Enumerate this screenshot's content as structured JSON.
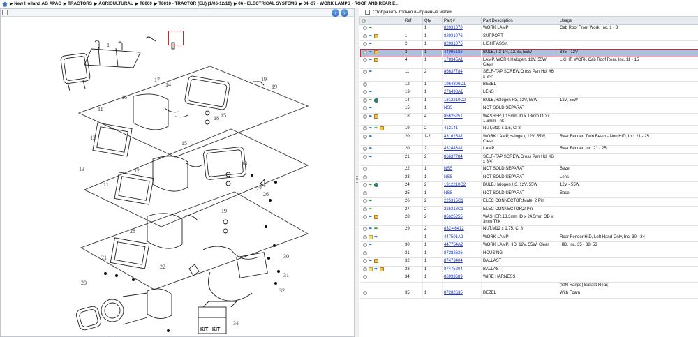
{
  "breadcrumb": [
    "New Holland AG APAC",
    "TRACTORS",
    "AGRICULTURAL",
    "T8000",
    "T8010 - TRACTOR (EU) (1/06-12/10)",
    "06 - ELECTRICAL SYSTEMS",
    "04 -37 - WORK LAMPS - ROOF AND REAR E.."
  ],
  "filter_label": "Отобразить только выбранные метки",
  "columns": {
    "ref": "Ref",
    "qty": "Qty.",
    "part": "Part #",
    "desc": "Part Description",
    "usage": "Usage"
  },
  "diagram_labels": {
    "kit": "KIT"
  },
  "rows": [
    {
      "icons": [
        "gear",
        "go"
      ],
      "ref": "",
      "qty": "1",
      "part": "82031070",
      "desc": "WORK LAMP",
      "usage": "Cab Roof Front Work, Inc. 1 - 3"
    },
    {
      "icons": [
        "gear",
        "arrow",
        "box"
      ],
      "ref": "1",
      "qty": "1",
      "part": "82031076",
      "desc": "SUPPORT",
      "usage": ""
    },
    {
      "icons": [
        "gear",
        "arrow"
      ],
      "ref": "2",
      "qty": "1",
      "part": "82031075",
      "desc": "LIGHT ASSY.",
      "usage": ""
    },
    {
      "icons": [
        "gear",
        "arrow",
        "box"
      ],
      "ref": "3",
      "qty": "1",
      "part": "44995182",
      "desc": "BULB,T-3 1/4, 12.8V, 55W",
      "usage": "885 - 12V",
      "selected": true
    },
    {
      "icons": [
        "gear",
        "arrow",
        "box"
      ],
      "ref": "4",
      "qty": "1",
      "part": "178345A1",
      "desc": "LAMP, WORK,Halogen, 12V, 55W, Clear",
      "usage": "LIGHT, WORK Cab Roof Rear, Inc. 11 - 15"
    },
    {
      "icons": [
        "gear",
        "arrow"
      ],
      "ref": "11",
      "qty": "2",
      "part": "86637784",
      "desc": "SELF-TAP SCREW,Cross Pan Hd, #6 x 3/4\"",
      "usage": ""
    },
    {
      "icons": [
        "gear"
      ],
      "ref": "12",
      "qty": "1",
      "part": "1964806C1",
      "desc": "BEZEL",
      "usage": ""
    },
    {
      "icons": [
        "gear",
        "arrow"
      ],
      "ref": "13",
      "qty": "1",
      "part": "276498A1",
      "desc": "LENS",
      "usage": ""
    },
    {
      "icons": [
        "gear",
        "go",
        "globe"
      ],
      "ref": "14",
      "qty": "1",
      "part": "1312210C2",
      "desc": "BULB,Halogen H3, 12V, 55W",
      "usage": "12V, 55W"
    },
    {
      "icons": [
        "gear",
        "arrow"
      ],
      "ref": "15",
      "qty": "1",
      "part": "NSS",
      "desc": "NOT SOLD SEPARAT",
      "usage": ""
    },
    {
      "icons": [
        "gear",
        "arrow",
        "box"
      ],
      "ref": "18",
      "qty": "4",
      "part": "86625251",
      "desc": "WASHER,10.5mm ID x 18mm OD x 1.6mm Thk",
      "usage": ""
    },
    {
      "icons": [
        "gear",
        "arrow",
        "go",
        "box"
      ],
      "ref": "19",
      "qty": "2",
      "part": "412141",
      "desc": "NUT,M10 x 1.5, Cl 8",
      "usage": ""
    },
    {
      "icons": [
        "gear",
        "arrow"
      ],
      "ref": "20",
      "qty": "1-2",
      "part": "431625A1",
      "desc": "WORK LAMP,Halogen, 12V, 55W, Clear",
      "usage": "Rear Fender, Twin Beam - Non HID, Inc. 21 - 25"
    },
    {
      "icons": [
        "gear",
        "arrow"
      ],
      "ref": "20",
      "qty": "2",
      "part": "432446A1",
      "desc": "LAMP",
      "usage": "Rear Fender, Inc. 21 - 25"
    },
    {
      "icons": [
        "gear",
        "arrow"
      ],
      "ref": "21",
      "qty": "2",
      "part": "86637784",
      "desc": "SELF-TAP SCREW,Cross Pan Hd, #6 x 3/4\"",
      "usage": ""
    },
    {
      "icons": [
        "gear"
      ],
      "ref": "22",
      "qty": "1",
      "part": "NSS",
      "desc": "NOT SOLD SEPARAT",
      "usage": "Bezel"
    },
    {
      "icons": [
        "gear"
      ],
      "ref": "23",
      "qty": "1",
      "part": "NSS",
      "desc": "NOT SOLD SEPARAT",
      "usage": "Lens"
    },
    {
      "icons": [
        "gear",
        "go",
        "globe"
      ],
      "ref": "24",
      "qty": "2",
      "part": "1312210C2",
      "desc": "BULB,Halogen H3, 12V, 55W",
      "usage": "12V - 55W"
    },
    {
      "icons": [
        "gear"
      ],
      "ref": "25",
      "qty": "1",
      "part": "NSS",
      "desc": "NOT SOLD SEPARAT",
      "usage": "Base"
    },
    {
      "icons": [
        "gear",
        "go"
      ],
      "ref": "26",
      "qty": "2",
      "part": "225315C1",
      "desc": "ELEC CONNECTOR,Male, 2 Pin",
      "usage": ""
    },
    {
      "icons": [
        "gear",
        "go"
      ],
      "ref": "27",
      "qty": "2",
      "part": "225318C1",
      "desc": "ELEC CONNECTOR,2 Pin",
      "usage": ""
    },
    {
      "icons": [
        "gear",
        "arrow",
        "box"
      ],
      "ref": "28",
      "qty": "2",
      "part": "86625255",
      "desc": "WASHER,13.3mm ID x 24.5mm OD x 3mm Thk",
      "usage": ""
    },
    {
      "icons": [
        "gear",
        "arrow",
        "go"
      ],
      "ref": "29",
      "qty": "2",
      "part": "832-46412",
      "desc": "NUT,M12 x 1.75, Cl 8",
      "usage": ""
    },
    {
      "icons": [
        "gear",
        "note",
        "arrow"
      ],
      "ref": "",
      "qty": "1",
      "part": "447501A2",
      "desc": "WORK LAMP",
      "usage": "Rear Fender HID, Left Hand Only, Inc. 30 - 34"
    },
    {
      "icons": [
        "gear",
        "arrow"
      ],
      "ref": "30",
      "qty": "1",
      "part": "447754A2",
      "desc": "WORK LAMP,HID, 12V, 55W, Clear",
      "usage": "HID, Inc. 35 - 38, 53"
    },
    {
      "icons": [
        "gear"
      ],
      "ref": "31",
      "qty": "1",
      "part": "87282636",
      "desc": "HOUSING",
      "usage": ""
    },
    {
      "icons": [
        "gear",
        "arrow",
        "box"
      ],
      "ref": "32",
      "qty": "1",
      "part": "87473404",
      "desc": "BALLAST",
      "usage": ""
    },
    {
      "icons": [
        "gear",
        "note",
        "arrow",
        "box"
      ],
      "ref": "33",
      "qty": "1",
      "part": "87475204",
      "desc": "BALLAST",
      "usage": ""
    },
    {
      "icons": [
        "gear"
      ],
      "ref": "34",
      "qty": "1",
      "part": "86993689",
      "desc": "WIRE HARNESS",
      "usage": ""
    },
    {
      "icons": [],
      "ref": "",
      "qty": "",
      "part": "",
      "desc": "",
      "usage": "(SIN Range) Ballast-Rear;"
    },
    {
      "icons": [
        "gear"
      ],
      "ref": "35",
      "qty": "1",
      "part": "87282635",
      "desc": "BEZEL",
      "usage": "With Foam"
    }
  ]
}
